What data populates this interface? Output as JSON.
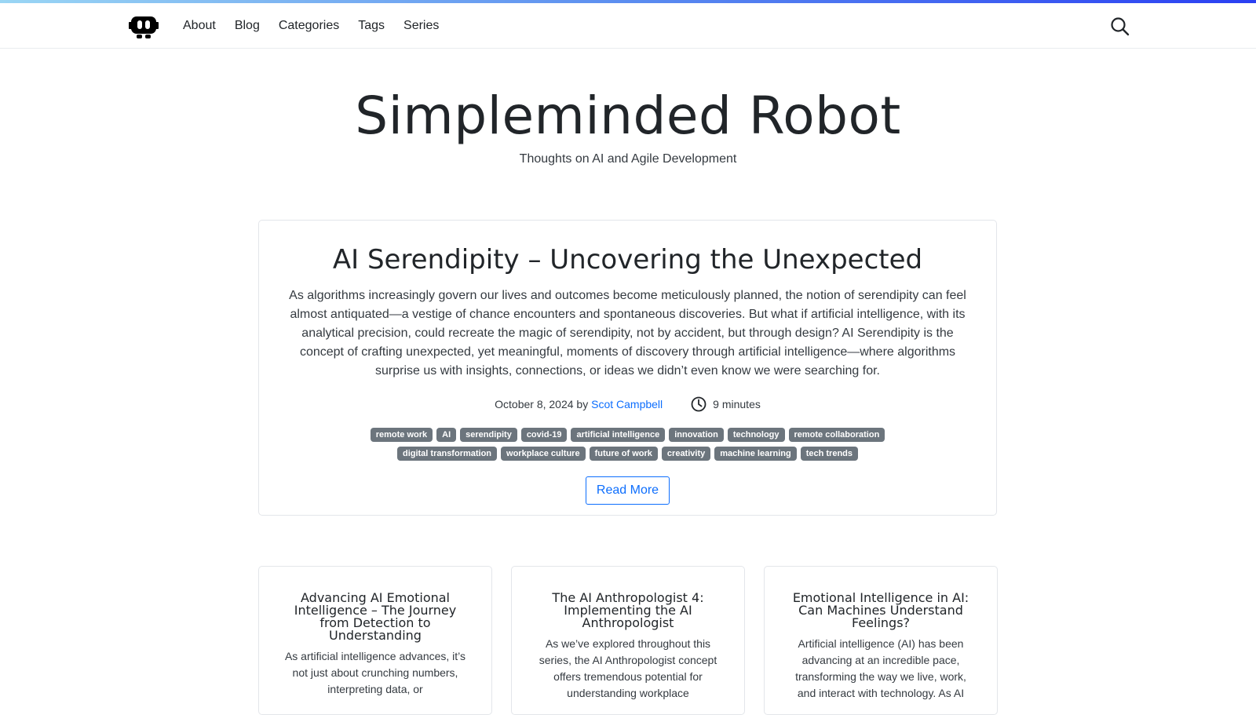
{
  "nav": {
    "items": [
      {
        "label": "About"
      },
      {
        "label": "Blog"
      },
      {
        "label": "Categories"
      },
      {
        "label": "Tags"
      },
      {
        "label": "Series"
      }
    ]
  },
  "hero": {
    "title": "Simpleminded Robot",
    "subtitle": "Thoughts on AI and Agile Development"
  },
  "featured": {
    "title": "AI Serendipity – Uncovering the Unexpected",
    "excerpt": "As algorithms increasingly govern our lives and outcomes become meticulously planned, the notion of serendipity can feel almost antiquated—a vestige of chance encounters and spontaneous discoveries. But what if artificial intelligence, with its analytical precision, could recreate the magic of serendipity, not by accident, but through design? AI Serendipity is the concept of crafting unexpected, yet meaningful, moments of discovery through artificial intelligence—where algorithms surprise us with insights, connections, or ideas we didn’t even know we were searching for.",
    "date": "October 8, 2024",
    "by": "by",
    "author": "Scot Campbell",
    "read_time": "9 minutes",
    "tags": [
      "remote work",
      "AI",
      "serendipity",
      "covid-19",
      "artificial intelligence",
      "innovation",
      "technology",
      "remote collaboration",
      "digital transformation",
      "workplace culture",
      "future of work",
      "creativity",
      "machine learning",
      "tech trends"
    ],
    "read_more": "Read More"
  },
  "posts": [
    {
      "title": "Advancing AI Emotional Intelligence – The Journey from Detection to Understanding",
      "excerpt": "As artificial intelligence advances, it’s not just about crunching numbers, interpreting data, or"
    },
    {
      "title": "The AI Anthropologist 4: Implementing the AI Anthropologist",
      "excerpt": "As we’ve explored throughout this series, the AI Anthropologist concept offers tremendous potential for understanding workplace"
    },
    {
      "title": "Emotional Intelligence in AI: Can Machines Understand Feelings?",
      "excerpt": "Artificial intelligence (AI) has been advancing at an incredible pace, transforming the way we live, work, and interact with technology. As AI"
    }
  ]
}
